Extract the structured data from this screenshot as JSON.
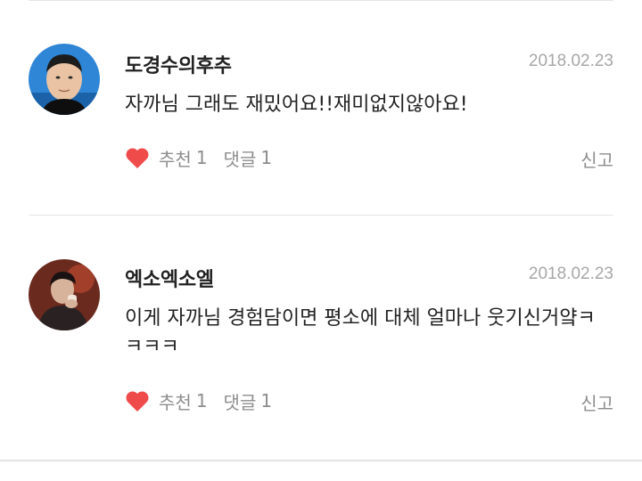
{
  "comments": [
    {
      "username": "도경수의후추",
      "date": "2018.02.23",
      "text": "자까님 그래도 재밌어요!!재미없지않아요!",
      "like_label": "추천",
      "like_count": "1",
      "reply_label": "댓글",
      "reply_count": "1",
      "report_label": "신고",
      "avatar_icon": "user-avatar-photo"
    },
    {
      "username": "엑소엑소엘",
      "date": "2018.02.23",
      "text": "이게 자까님 경험담이면 평소에 대체 얼마나 웃기신거얔ㅋㅋㅋㅋ",
      "like_label": "추천",
      "like_count": "1",
      "reply_label": "댓글",
      "reply_count": "1",
      "report_label": "신고",
      "avatar_icon": "user-avatar-photo"
    }
  ],
  "colors": {
    "heart": "#f04b4b",
    "meta_text": "#8d8d8d",
    "date_text": "#a7a7a7",
    "divider": "#e5e5e5"
  }
}
